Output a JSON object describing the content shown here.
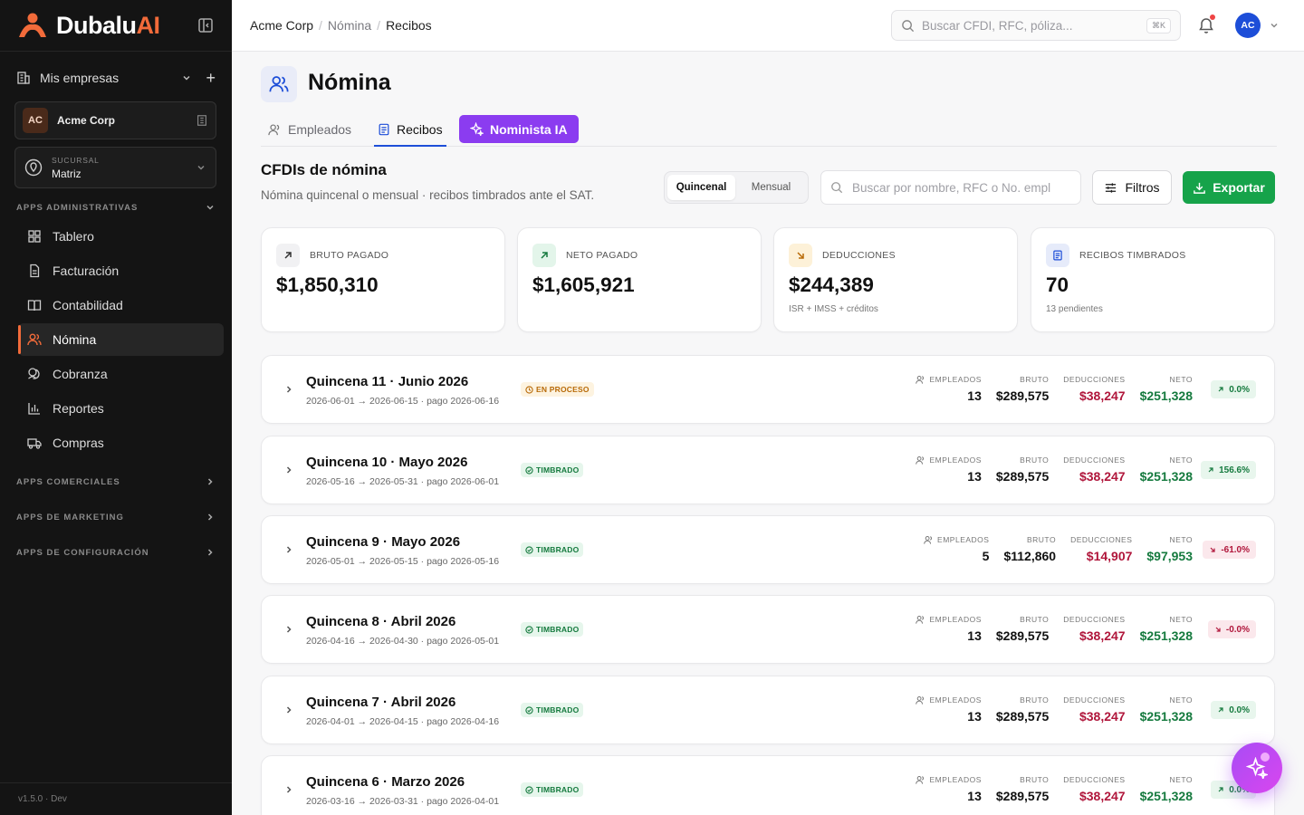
{
  "brand": {
    "name": "Dubalu",
    "suffix": "AI"
  },
  "sidebar": {
    "mis_empresas": "Mis empresas",
    "company": {
      "initials": "AC",
      "name": "Acme Corp"
    },
    "sucursal": {
      "label": "SUCURSAL",
      "value": "Matriz"
    },
    "sections": {
      "admin": "APPS ADMINISTRATIVAS",
      "comerciales": "APPS COMERCIALES",
      "marketing": "APPS DE MARKETING",
      "config": "APPS DE CONFIGURACIÓN"
    },
    "items": [
      {
        "label": "Tablero",
        "icon": "grid-icon"
      },
      {
        "label": "Facturación",
        "icon": "document-icon"
      },
      {
        "label": "Contabilidad",
        "icon": "book-icon"
      },
      {
        "label": "Nómina",
        "icon": "users-icon",
        "active": true
      },
      {
        "label": "Cobranza",
        "icon": "coins-icon"
      },
      {
        "label": "Reportes",
        "icon": "bar-chart-icon"
      },
      {
        "label": "Compras",
        "icon": "truck-icon"
      }
    ],
    "version": "v1.5.0 · Dev"
  },
  "topbar": {
    "breadcrumb": [
      "Acme Corp",
      "Nómina",
      "Recibos"
    ],
    "search_placeholder": "Buscar CFDI, RFC, póliza...",
    "shortcut": "⌘K",
    "user_initials": "AC"
  },
  "page": {
    "title": "Nómina",
    "tabs": [
      "Empleados",
      "Recibos",
      "Nominista IA"
    ],
    "section_title": "CFDIs de nómina",
    "section_subtitle": "Nómina quincenal o mensual · recibos timbrados ante el SAT.",
    "period_toggle": [
      "Quincenal",
      "Mensual"
    ],
    "search_placeholder": "Buscar por nombre, RFC o No. empl",
    "filters_label": "Filtros",
    "export_label": "Exportar"
  },
  "kpis": [
    {
      "label": "BRUTO PAGADO",
      "value": "$1,850,310",
      "sub": ""
    },
    {
      "label": "NETO PAGADO",
      "value": "$1,605,921",
      "sub": ""
    },
    {
      "label": "DEDUCCIONES",
      "value": "$244,389",
      "sub": "ISR + IMSS + créditos"
    },
    {
      "label": "RECIBOS TIMBRADOS",
      "value": "70",
      "sub": "13 pendientes"
    }
  ],
  "metric_labels": {
    "empleados": "EMPLEADOS",
    "bruto": "BRUTO",
    "deducciones": "DEDUCCIONES",
    "neto": "NETO"
  },
  "rows": [
    {
      "title": "Quincena 11 · Junio 2026",
      "dates": "2026-06-01 → 2026-06-15 · pago 2026-06-16",
      "status": "EN PROCESO",
      "empleados": "13",
      "bruto": "$289,575",
      "deducciones": "$38,247",
      "neto": "$251,328",
      "delta": "0.0%",
      "trend": "up"
    },
    {
      "title": "Quincena 10 · Mayo 2026",
      "dates": "2026-05-16 → 2026-05-31 · pago 2026-06-01",
      "status": "TIMBRADO",
      "empleados": "13",
      "bruto": "$289,575",
      "deducciones": "$38,247",
      "neto": "$251,328",
      "delta": "156.6%",
      "trend": "up"
    },
    {
      "title": "Quincena 9 · Mayo 2026",
      "dates": "2026-05-01 → 2026-05-15 · pago 2026-05-16",
      "status": "TIMBRADO",
      "empleados": "5",
      "bruto": "$112,860",
      "deducciones": "$14,907",
      "neto": "$97,953",
      "delta": "-61.0%",
      "trend": "down"
    },
    {
      "title": "Quincena 8 · Abril 2026",
      "dates": "2026-04-16 → 2026-04-30 · pago 2026-05-01",
      "status": "TIMBRADO",
      "empleados": "13",
      "bruto": "$289,575",
      "deducciones": "$38,247",
      "neto": "$251,328",
      "delta": "-0.0%",
      "trend": "down"
    },
    {
      "title": "Quincena 7 · Abril 2026",
      "dates": "2026-04-01 → 2026-04-15 · pago 2026-04-16",
      "status": "TIMBRADO",
      "empleados": "13",
      "bruto": "$289,575",
      "deducciones": "$38,247",
      "neto": "$251,328",
      "delta": "0.0%",
      "trend": "up"
    },
    {
      "title": "Quincena 6 · Marzo 2026",
      "dates": "2026-03-16 → 2026-03-31 · pago 2026-04-01",
      "status": "TIMBRADO",
      "empleados": "13",
      "bruto": "$289,575",
      "deducciones": "$38,247",
      "neto": "$251,328",
      "delta": "0.0%",
      "trend": "up"
    }
  ],
  "colors": {
    "accent": "#f26b3a",
    "primary": "#1d4ed8",
    "ai": "#8b3cf0",
    "success": "#16a34a",
    "danger": "#b0163b"
  }
}
